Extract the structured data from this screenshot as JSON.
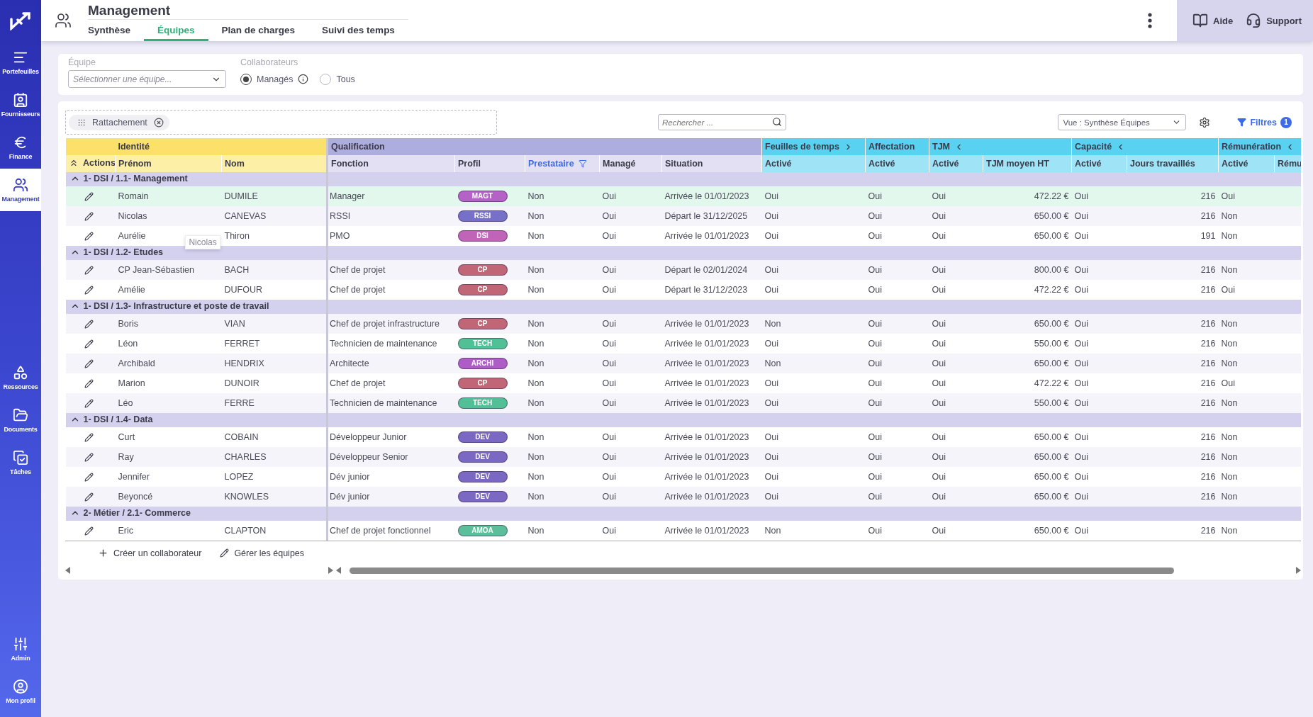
{
  "sidebar": {
    "sections": [
      [
        {
          "label": "Portefeuilles",
          "selected": false
        },
        {
          "label": "Fournisseurs",
          "selected": false
        },
        {
          "label": "Finance",
          "selected": false
        },
        {
          "label": "Management",
          "selected": true
        }
      ],
      [
        {
          "label": "Ressources",
          "selected": false
        },
        {
          "label": "Documents",
          "selected": false
        },
        {
          "label": "Tâches",
          "selected": false
        }
      ],
      [
        {
          "label": "Admin",
          "selected": false
        },
        {
          "label": "Mon profil",
          "selected": false
        }
      ]
    ]
  },
  "header": {
    "title": "Management",
    "tabs": [
      {
        "label": "Synthèse",
        "selected": false
      },
      {
        "label": "Équipes",
        "selected": true
      },
      {
        "label": "Plan de charges",
        "selected": false
      },
      {
        "label": "Suivi des temps",
        "selected": false
      }
    ],
    "help": "Aide",
    "support": "Support"
  },
  "filters": {
    "team_label": "Équipe",
    "team_placeholder": "Sélectionner une équipe...",
    "collab_label": "Collaborateurs",
    "radios": [
      {
        "label": "Managés",
        "selected": true
      },
      {
        "label": "Tous",
        "selected": false
      }
    ]
  },
  "toolbar": {
    "chip": "Rattachement",
    "search_placeholder": "Rechercher ...",
    "view": "Vue : Synthèse Équipes",
    "filters": "Filtres",
    "filter_count": "1"
  },
  "table": {
    "column_groups": [
      {
        "label": "Identité",
        "kind": "identity"
      },
      {
        "label": "Qualification",
        "kind": "qualification"
      },
      {
        "label": "Feuilles de temps",
        "kind": "indicator",
        "expanded": false
      },
      {
        "label": "Affectation",
        "kind": "indicator"
      },
      {
        "label": "TJM",
        "kind": "indicator",
        "expanded": true
      },
      {
        "label": "Capacité",
        "kind": "indicator",
        "expanded": true
      },
      {
        "label": "Rémunération",
        "kind": "indicator",
        "expanded": true
      }
    ],
    "actions_label": "Actions",
    "columns": [
      {
        "label": "Prénom",
        "filtered": false
      },
      {
        "label": "Nom",
        "filtered": false
      },
      {
        "label": "Fonction",
        "filtered": false
      },
      {
        "label": "Profil",
        "filtered": false
      },
      {
        "label": "Prestataire",
        "filtered": true
      },
      {
        "label": "Managé",
        "filtered": false
      },
      {
        "label": "Situation",
        "filtered": false
      },
      {
        "label": "Activé",
        "filtered": false
      },
      {
        "label": "Activé",
        "filtered": false
      },
      {
        "label": "Activé",
        "filtered": false
      },
      {
        "label": "TJM moyen HT",
        "filtered": false
      },
      {
        "label": "Activé",
        "filtered": false
      },
      {
        "label": "Jours travaillés",
        "filtered": false
      },
      {
        "label": "Activé",
        "filtered": false
      },
      {
        "label": "Rému",
        "filtered": false
      }
    ],
    "groups": [
      {
        "label": "1- DSI / 1.1- Management",
        "expanded": true,
        "rows": [
          {
            "highlighted": true,
            "first": "Romain",
            "last": "DUMILE",
            "function": "Manager",
            "profile": "MAGT",
            "color": "#b562c8",
            "cells": [
              "Non",
              "Oui",
              "Arrivée le 01/01/2023",
              "Oui",
              "Oui",
              "Oui",
              "472.22 €",
              "Oui",
              "216",
              "Oui"
            ]
          },
          {
            "highlighted": false,
            "first": "Nicolas",
            "last": "CANEVAS",
            "function": "RSSI",
            "profile": "RSSI",
            "color": "#7670c8",
            "cells": [
              "Non",
              "Oui",
              "Départ le 31/12/2025",
              "Oui",
              "Oui",
              "Oui",
              "650.00 €",
              "Oui",
              "216",
              "Non"
            ]
          },
          {
            "highlighted": false,
            "first": "Aurélie",
            "tooltip": "Nicolas",
            "last": "Thiron",
            "function": "PMO",
            "profile": "DSI",
            "color": "#c064b8",
            "cells": [
              "Non",
              "Oui",
              "Arrivée le 01/01/2023",
              "Oui",
              "Oui",
              "Oui",
              "650.00 €",
              "Oui",
              "191",
              "Non"
            ]
          }
        ]
      },
      {
        "label": "1- DSI / 1.2- Etudes",
        "expanded": true,
        "rows": [
          {
            "highlighted": false,
            "first": "CP Jean-Sébastien",
            "last": "BACH",
            "function": "Chef de projet",
            "profile": "CP",
            "color": "#c06676",
            "cells": [
              "Non",
              "Oui",
              "Départ le 02/01/2024",
              "Oui",
              "Oui",
              "Oui",
              "800.00 €",
              "Oui",
              "216",
              "Non"
            ]
          },
          {
            "highlighted": false,
            "first": "Amélie",
            "last": "DUFOUR",
            "function": "Chef de projet",
            "profile": "CP",
            "color": "#c06676",
            "cells": [
              "Non",
              "Oui",
              "Départ le 31/12/2023",
              "Oui",
              "Oui",
              "Oui",
              "472.22 €",
              "Oui",
              "216",
              "Oui"
            ]
          }
        ]
      },
      {
        "label": "1- DSI / 1.3- Infrastructure et poste de travail",
        "expanded": true,
        "rows": [
          {
            "highlighted": false,
            "first": "Boris",
            "last": "VIAN",
            "function": "Chef de projet infrastructure",
            "profile": "CP",
            "color": "#c06676",
            "cells": [
              "Non",
              "Oui",
              "Arrivée le 01/01/2023",
              "Non",
              "Oui",
              "Oui",
              "650.00 €",
              "Oui",
              "216",
              "Non"
            ]
          },
          {
            "highlighted": false,
            "first": "Léon",
            "last": "FERRET",
            "function": "Technicien de maintenance",
            "profile": "TECH",
            "color": "#52c096",
            "cells": [
              "Non",
              "Oui",
              "Arrivée le 01/01/2023",
              "Oui",
              "Oui",
              "Oui",
              "550.00 €",
              "Oui",
              "216",
              "Non"
            ]
          },
          {
            "highlighted": false,
            "first": "Archibald",
            "last": "HENDRIX",
            "function": "Architecte",
            "profile": "ARCHI",
            "color": "#ae5cc6",
            "cells": [
              "Non",
              "Oui",
              "Arrivée le 01/01/2023",
              "Non",
              "Oui",
              "Oui",
              "650.00 €",
              "Oui",
              "216",
              "Non"
            ]
          },
          {
            "highlighted": false,
            "first": "Marion",
            "last": "DUNOIR",
            "function": "Chef de projet",
            "profile": "CP",
            "color": "#c06676",
            "cells": [
              "Non",
              "Oui",
              "Arrivée le 01/01/2023",
              "Oui",
              "Oui",
              "Oui",
              "472.22 €",
              "Oui",
              "216",
              "Oui"
            ]
          },
          {
            "highlighted": false,
            "first": "Léo",
            "last": "FERRE",
            "function": "Technicien de maintenance",
            "profile": "TECH",
            "color": "#52c096",
            "cells": [
              "Non",
              "Oui",
              "Arrivée le 01/01/2023",
              "Oui",
              "Oui",
              "Oui",
              "550.00 €",
              "Oui",
              "216",
              "Non"
            ]
          }
        ]
      },
      {
        "label": "1- DSI / 1.4- Data",
        "expanded": true,
        "rows": [
          {
            "highlighted": false,
            "first": "Curt",
            "last": "COBAIN",
            "function": "Développeur Junior",
            "profile": "DEV",
            "color": "#7a68c2",
            "cells": [
              "Non",
              "Oui",
              "Arrivée le 01/01/2023",
              "Oui",
              "Oui",
              "Oui",
              "650.00 €",
              "Oui",
              "216",
              "Non"
            ]
          },
          {
            "highlighted": false,
            "first": "Ray",
            "last": "CHARLES",
            "function": "Développeur Senior",
            "profile": "DEV",
            "color": "#7a68c2",
            "cells": [
              "Non",
              "Oui",
              "Arrivée le 01/01/2023",
              "Oui",
              "Oui",
              "Oui",
              "650.00 €",
              "Oui",
              "216",
              "Non"
            ]
          },
          {
            "highlighted": false,
            "first": "Jennifer",
            "last": "LOPEZ",
            "function": "Dév junior",
            "profile": "DEV",
            "color": "#7a68c2",
            "cells": [
              "Non",
              "Oui",
              "Arrivée le 01/01/2023",
              "Oui",
              "Oui",
              "Oui",
              "650.00 €",
              "Oui",
              "216",
              "Non"
            ]
          },
          {
            "highlighted": false,
            "first": "Beyoncé",
            "last": "KNOWLES",
            "function": "Dév junior",
            "profile": "DEV",
            "color": "#7a68c2",
            "cells": [
              "Non",
              "Oui",
              "Arrivée le 01/01/2023",
              "Oui",
              "Oui",
              "Oui",
              "650.00 €",
              "Oui",
              "216",
              "Non"
            ]
          }
        ]
      },
      {
        "label": "2- Métier / 2.1- Commerce",
        "expanded": true,
        "rows": [
          {
            "highlighted": false,
            "first": "Eric",
            "last": "CLAPTON",
            "function": "Chef de projet fonctionnel",
            "profile": "AMOA",
            "color": "#5abf9a",
            "cells": [
              "Non",
              "Oui",
              "Arrivée le 01/01/2023",
              "Non",
              "Oui",
              "Oui",
              "650.00 €",
              "Oui",
              "216",
              "Non"
            ]
          }
        ]
      }
    ]
  },
  "footer": {
    "actions": [
      {
        "label": "Créer un collaborateur"
      },
      {
        "label": "Gérer les équipes"
      }
    ]
  }
}
